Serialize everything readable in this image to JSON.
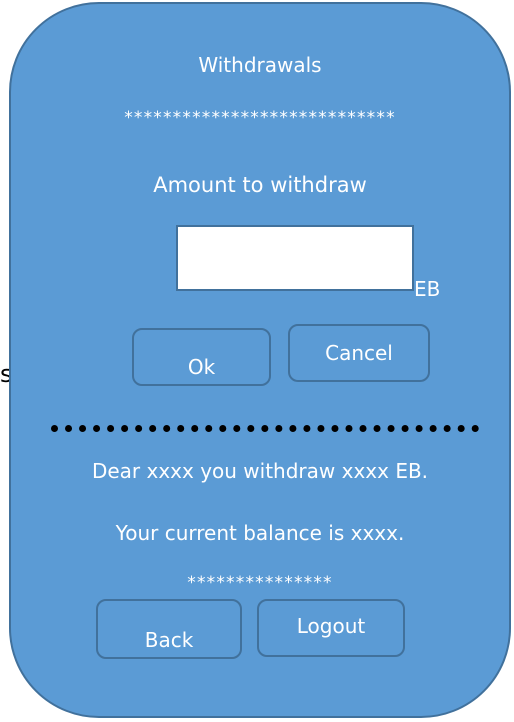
{
  "edge_fragment": "s",
  "screen": {
    "title": "Withdrawals",
    "stars_top": "****************************",
    "amount_label": "Amount to withdraw",
    "amount_value": "",
    "unit": "EB",
    "ok_label": "Ok",
    "cancel_label": "Cancel",
    "message_withdraw": "Dear xxxx you withdraw xxxx EB.",
    "message_balance": "Your current balance is xxxx.",
    "stars_bottom": "***************",
    "back_label": "Back",
    "logout_label": "Logout"
  },
  "colors": {
    "panel_fill": "#5b9bd5",
    "panel_border": "#41719c",
    "text": "#ffffff",
    "separator": "#000000"
  }
}
